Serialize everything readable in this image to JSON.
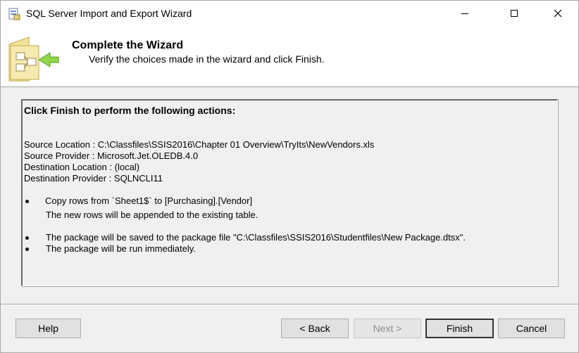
{
  "window": {
    "title": "SQL Server Import and Export Wizard"
  },
  "header": {
    "title": "Complete the Wizard",
    "subtitle": "Verify the choices made in the wizard and click Finish."
  },
  "summary": {
    "heading": "Click Finish to perform the following actions:",
    "details": [
      "Source Location : C:\\Classfiles\\SSIS2016\\Chapter 01 Overview\\TryIts\\NewVendors.xls",
      "Source Provider : Microsoft.Jet.OLEDB.4.0",
      "Destination Location : (local)",
      "Destination Provider : SQLNCLI11"
    ],
    "copy_action": "Copy rows from `Sheet1$` to [Purchasing].[Vendor]",
    "copy_note": "The new rows will be appended to the existing table.",
    "save_action": "The package will be saved to the package file \"C:\\Classfiles\\SSIS2016\\Studentfiles\\New Package.dtsx\".",
    "run_action": "The package will be run immediately."
  },
  "buttons": {
    "help": "Help",
    "back": "< Back",
    "next": "Next >",
    "finish": "Finish",
    "cancel": "Cancel"
  },
  "icons": {
    "app": "sql-wizard-icon",
    "header": "wizard-folder-icon",
    "minimize": "minimize-icon",
    "maximize": "maximize-icon",
    "close": "close-icon"
  }
}
